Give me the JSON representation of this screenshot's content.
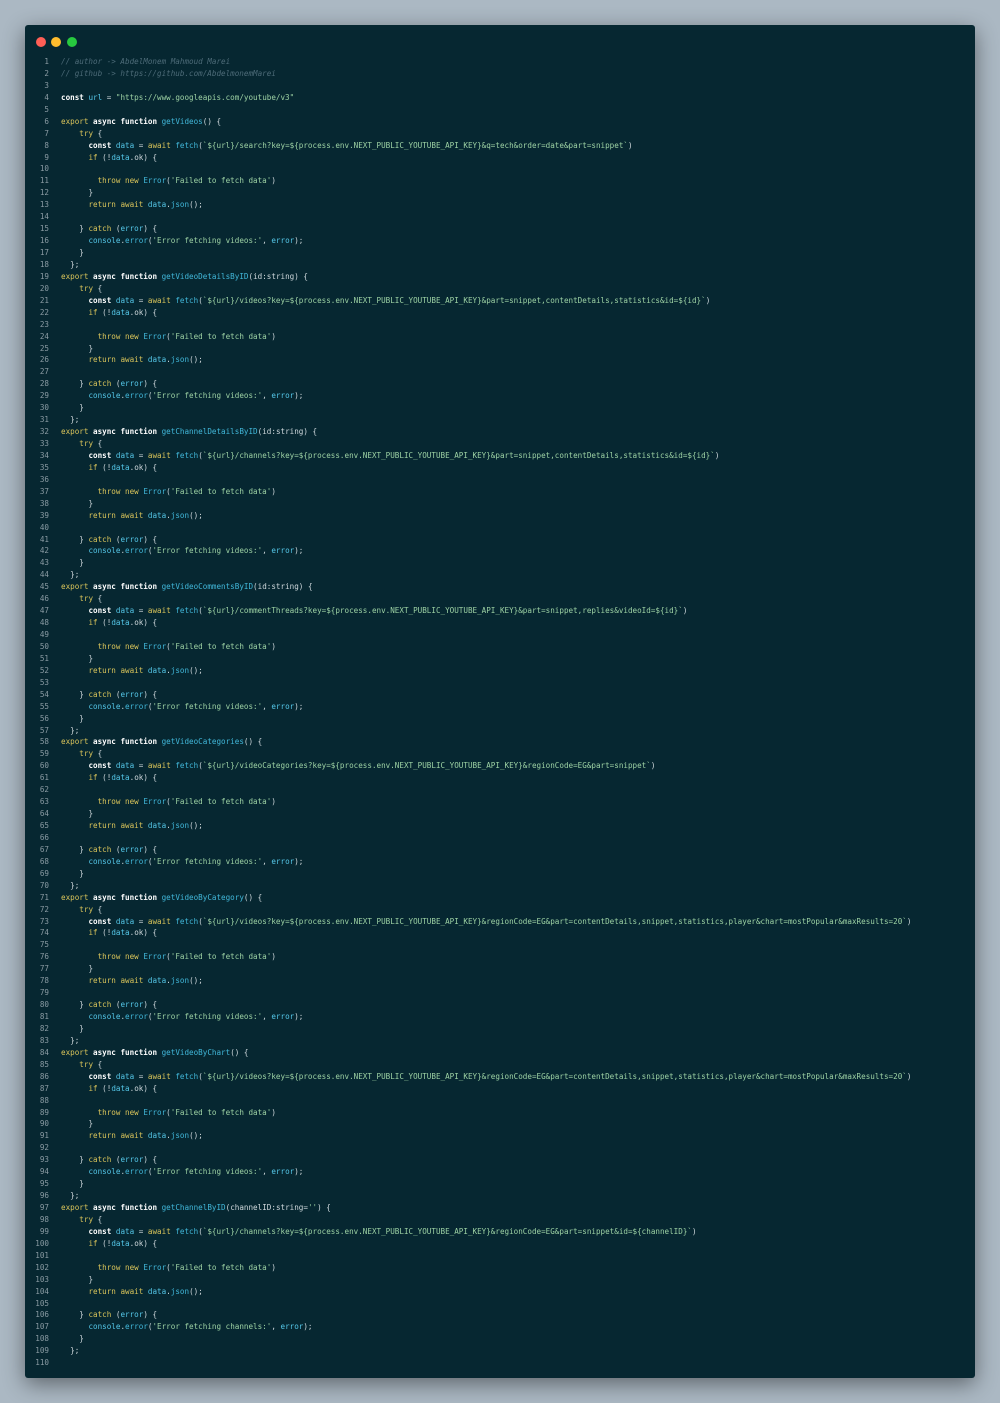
{
  "window": {
    "controls": [
      "close",
      "minimize",
      "maximize"
    ],
    "colors": {
      "close": "#ff5f56",
      "minimize": "#ffbd2e",
      "maximize": "#27c93f",
      "background": "#062731"
    }
  },
  "code": {
    "language": "javascript",
    "lines": [
      "// author -> AbdelMonem Mahmoud Marei",
      "// github -> https://github.com/AbdelmonemMarei",
      "",
      "const url = \"https://www.googleapis.com/youtube/v3\"",
      "",
      "export async function getVideos() {",
      "    try {",
      "      const data = await fetch(`${url}/search?key=${process.env.NEXT_PUBLIC_YOUTUBE_API_KEY}&q=tech&order=date&part=snippet`)",
      "      if (!data.ok) {",
      "",
      "        throw new Error('Failed to fetch data')",
      "      }",
      "      return await data.json();",
      "",
      "    } catch (error) {",
      "      console.error('Error fetching videos:', error);",
      "    }",
      "  };",
      "export async function getVideoDetailsByID(id:string) {",
      "    try {",
      "      const data = await fetch(`${url}/videos?key=${process.env.NEXT_PUBLIC_YOUTUBE_API_KEY}&part=snippet,contentDetails,statistics&id=${id}`)",
      "      if (!data.ok) {",
      "",
      "        throw new Error('Failed to fetch data')",
      "      }",
      "      return await data.json();",
      "",
      "    } catch (error) {",
      "      console.error('Error fetching videos:', error);",
      "    }",
      "  };",
      "export async function getChannelDetailsByID(id:string) {",
      "    try {",
      "      const data = await fetch(`${url}/channels?key=${process.env.NEXT_PUBLIC_YOUTUBE_API_KEY}&part=snippet,contentDetails,statistics&id=${id}`)",
      "      if (!data.ok) {",
      "",
      "        throw new Error('Failed to fetch data')",
      "      }",
      "      return await data.json();",
      "",
      "    } catch (error) {",
      "      console.error('Error fetching videos:', error);",
      "    }",
      "  };",
      "export async function getVideoCommentsByID(id:string) {",
      "    try {",
      "      const data = await fetch(`${url}/commentThreads?key=${process.env.NEXT_PUBLIC_YOUTUBE_API_KEY}&part=snippet,replies&videoId=${id}`)",
      "      if (!data.ok) {",
      "",
      "        throw new Error('Failed to fetch data')",
      "      }",
      "      return await data.json();",
      "",
      "    } catch (error) {",
      "      console.error('Error fetching videos:', error);",
      "    }",
      "  };",
      "export async function getVideoCategories() {",
      "    try {",
      "      const data = await fetch(`${url}/videoCategories?key=${process.env.NEXT_PUBLIC_YOUTUBE_API_KEY}&regionCode=EG&part=snippet`)",
      "      if (!data.ok) {",
      "",
      "        throw new Error('Failed to fetch data')",
      "      }",
      "      return await data.json();",
      "",
      "    } catch (error) {",
      "      console.error('Error fetching videos:', error);",
      "    }",
      "  };",
      "export async function getVideoByCategory() {",
      "    try {",
      "      const data = await fetch(`${url}/videos?key=${process.env.NEXT_PUBLIC_YOUTUBE_API_KEY}&regionCode=EG&part=contentDetails,snippet,statistics,player&chart=mostPopular&maxResults=20`)",
      "      if (!data.ok) {",
      "",
      "        throw new Error('Failed to fetch data')",
      "      }",
      "      return await data.json();",
      "",
      "    } catch (error) {",
      "      console.error('Error fetching videos:', error);",
      "    }",
      "  };",
      "export async function getVideoByChart() {",
      "    try {",
      "      const data = await fetch(`${url}/videos?key=${process.env.NEXT_PUBLIC_YOUTUBE_API_KEY}&regionCode=EG&part=contentDetails,snippet,statistics,player&chart=mostPopular&maxResults=20`)",
      "      if (!data.ok) {",
      "",
      "        throw new Error('Failed to fetch data')",
      "      }",
      "      return await data.json();",
      "",
      "    } catch (error) {",
      "      console.error('Error fetching videos:', error);",
      "    }",
      "  };",
      "export async function getChannelByID(channelID:string='') {",
      "    try {",
      "      const data = await fetch(`${url}/channels?key=${process.env.NEXT_PUBLIC_YOUTUBE_API_KEY}&regionCode=EG&part=snippet&id=${channelID}`)",
      "      if (!data.ok) {",
      "",
      "        throw new Error('Failed to fetch data')",
      "      }",
      "      return await data.json();",
      "",
      "    } catch (error) {",
      "      console.error('Error fetching channels:', error);",
      "    }",
      "  };",
      ""
    ]
  }
}
